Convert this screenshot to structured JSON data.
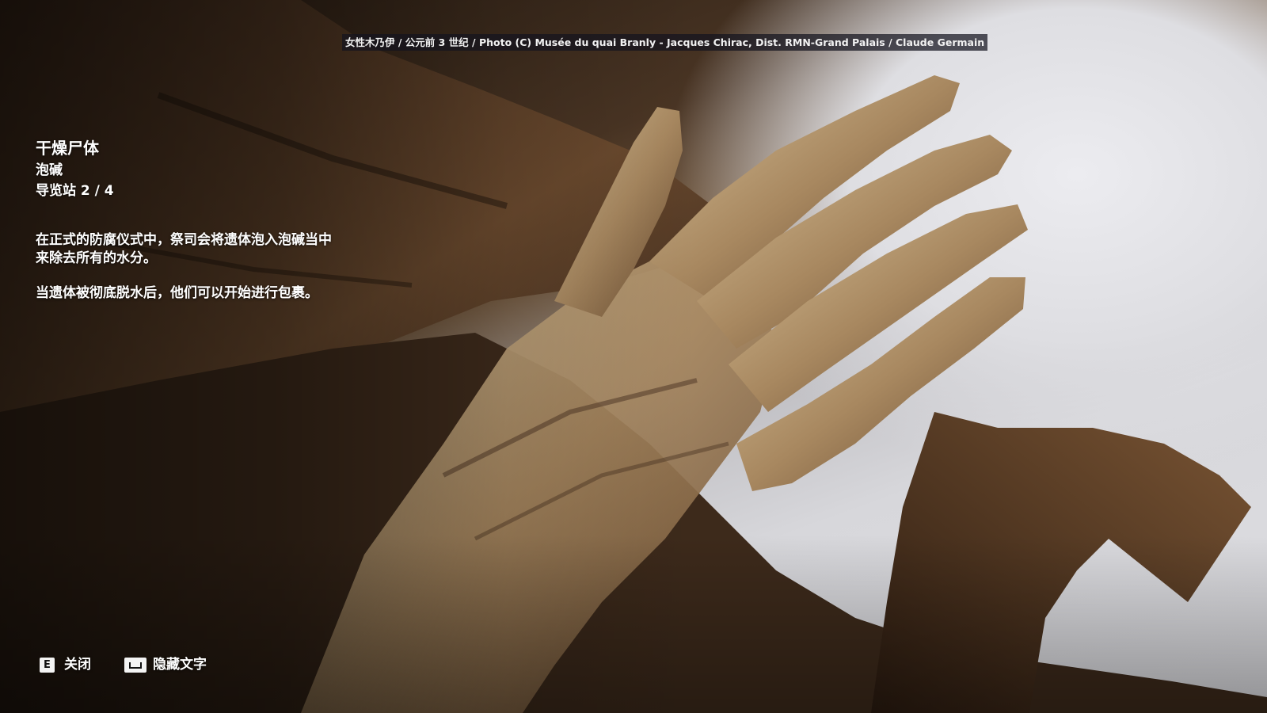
{
  "credit": {
    "text": "女性木乃伊 / 公元前 3 世纪 / Photo (C) Musée du quai Branly - Jacques Chirac, Dist. RMN-Grand Palais / Claude Germain"
  },
  "entry": {
    "title": "干燥尸体",
    "subtitle": "泡碱",
    "station": "导览站 2 / 4",
    "paragraphs": [
      "在正式的防腐仪式中，祭司会将遗体泡入泡碱当中\n来除去所有的水分。",
      "当遗体被彻底脱水后，他们可以开始进行包裹。"
    ]
  },
  "controls": {
    "close": {
      "key": "E",
      "label": "关闭"
    },
    "hide_text": {
      "key_icon": "spacebar-icon",
      "label": "隐藏文字"
    }
  },
  "colors": {
    "text": "#ffffff",
    "key_background": "#f4f4f4",
    "credit_background": "#14141e"
  }
}
